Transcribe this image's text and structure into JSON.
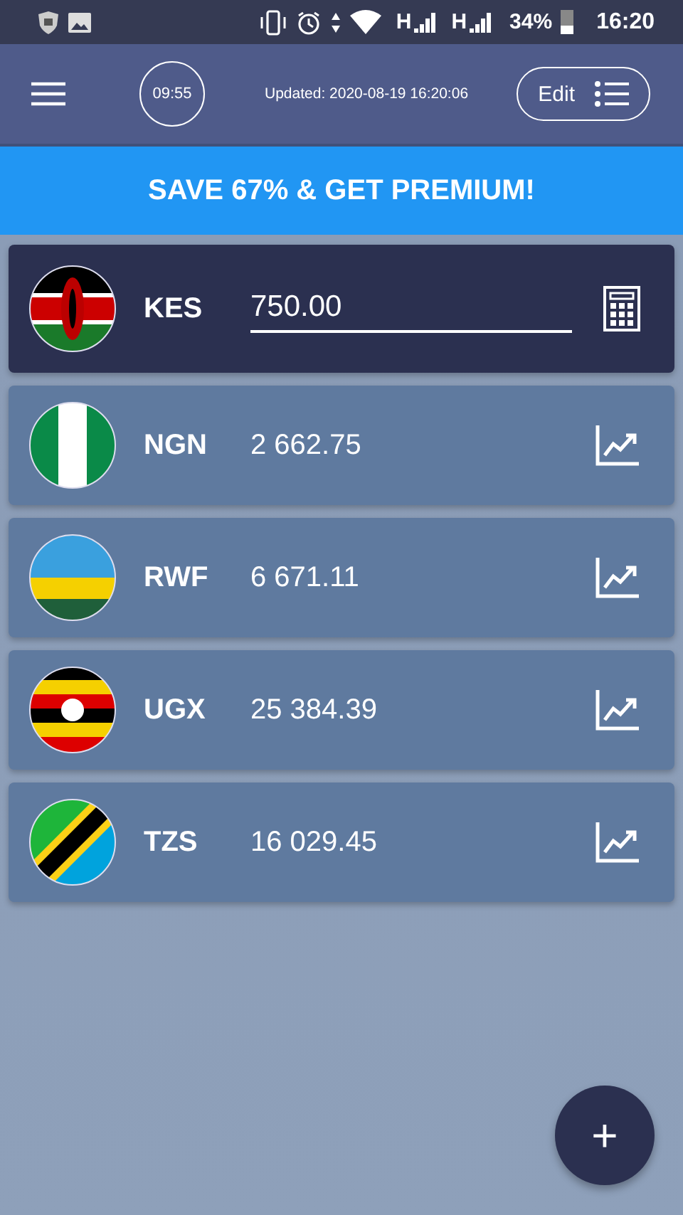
{
  "status_bar": {
    "network_labels": [
      "H",
      "H"
    ],
    "battery": "34%",
    "time": "16:20"
  },
  "header": {
    "timer": "09:55",
    "updated": "Updated: 2020-08-19 16:20:06",
    "edit_button": "Edit"
  },
  "banner": "SAVE 67% & GET PREMIUM!",
  "currencies": [
    {
      "code": "KES",
      "value": "750.00",
      "kind": "kenya",
      "selected": true
    },
    {
      "code": "NGN",
      "value": "2 662.75",
      "kind": "nigeria",
      "selected": false
    },
    {
      "code": "RWF",
      "value": "6 671.11",
      "kind": "rwanda",
      "selected": false
    },
    {
      "code": "UGX",
      "value": "25 384.39",
      "kind": "uganda",
      "selected": false
    },
    {
      "code": "TZS",
      "value": "16 029.45",
      "kind": "tanzania",
      "selected": false
    }
  ],
  "fab": "+"
}
